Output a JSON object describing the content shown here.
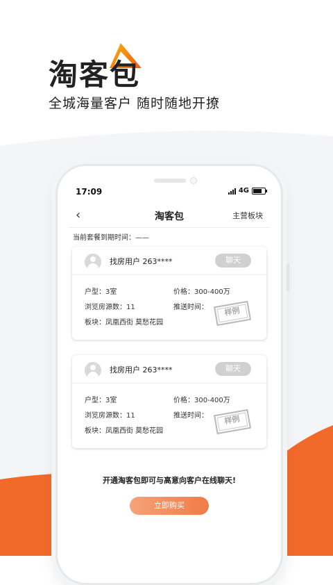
{
  "hero": {
    "title": "淘客包",
    "subtitle": "全城海量客户 随时随地开撩"
  },
  "colors": {
    "accent": "#f26a2a",
    "accent_light": "#f7a26f",
    "button_gray": "#d0d0d0"
  },
  "status_bar": {
    "time": "17:09",
    "network": "4G"
  },
  "nav": {
    "back_icon": "chevron-left-icon",
    "title": "淘客包",
    "right_action": "主营板块"
  },
  "expire_text": "当前套餐到期时间：——",
  "cards": [
    {
      "user": "找房用户 263****",
      "chat_label": "聊天",
      "layout_label": "户型：3室",
      "price_label": "价格：300-400万",
      "views_label": "浏览房源数：11",
      "push_label": "推送时间：",
      "area_label": "板块：凤凰西街   莫愁花园",
      "stamp": "样例"
    },
    {
      "user": "找房用户 263****",
      "chat_label": "聊天",
      "layout_label": "户型：3室",
      "price_label": "价格：300-400万",
      "views_label": "浏览房源数：11",
      "push_label": "推送时间：",
      "area_label": "板块：凤凰西街   莫愁花园",
      "stamp": "样例"
    }
  ],
  "promo_text": "开通淘客包即可与高意向客户在线聊天!",
  "buy_button": "立即购买"
}
